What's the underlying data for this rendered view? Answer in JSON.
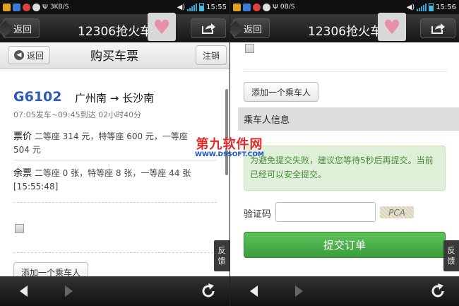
{
  "status_left": {
    "speed": "3KB/S",
    "time": "15:55"
  },
  "status_right": {
    "speed": "0B/S",
    "time": "15:56"
  },
  "titlebar": {
    "back_label": "返回",
    "title": "12306抢火车票"
  },
  "left": {
    "header": {
      "back_label": "返回",
      "title": "购买车票",
      "cancel_label": "注销"
    },
    "train": {
      "number": "G6102",
      "route": "广州南 → 长沙南",
      "times": "07:05发车~09:45到达 02小时40分",
      "price_label": "票价",
      "price_text": "二等座 314 元，特等座 600 元，一等座 504 元",
      "remain_label": "余票",
      "remain_text": "二等座 0 张，特等座 8 张，一等座 44 张",
      "remain_time": "[15:55:48]"
    },
    "add_passenger": "添加一个乘车人",
    "feedback": [
      "反",
      "馈"
    ]
  },
  "right": {
    "add_passenger": "添加一个乘车人",
    "section_title": "乘车人信息",
    "notice": "为避免提交失败，建议您等待5秒后再提交。当前已经可以安全提交。",
    "captcha_label": "验证码",
    "captcha_text": "PCA",
    "submit_label": "提交订单",
    "feedback": [
      "反",
      "馈"
    ]
  },
  "watermark": {
    "line1": "第九软件网",
    "line2": "WWW.D9SOFT.COM"
  },
  "colors": {
    "train_number": "#2a5ab8",
    "submit": "#4cb04c",
    "notice_bg": "#dff0d8"
  }
}
